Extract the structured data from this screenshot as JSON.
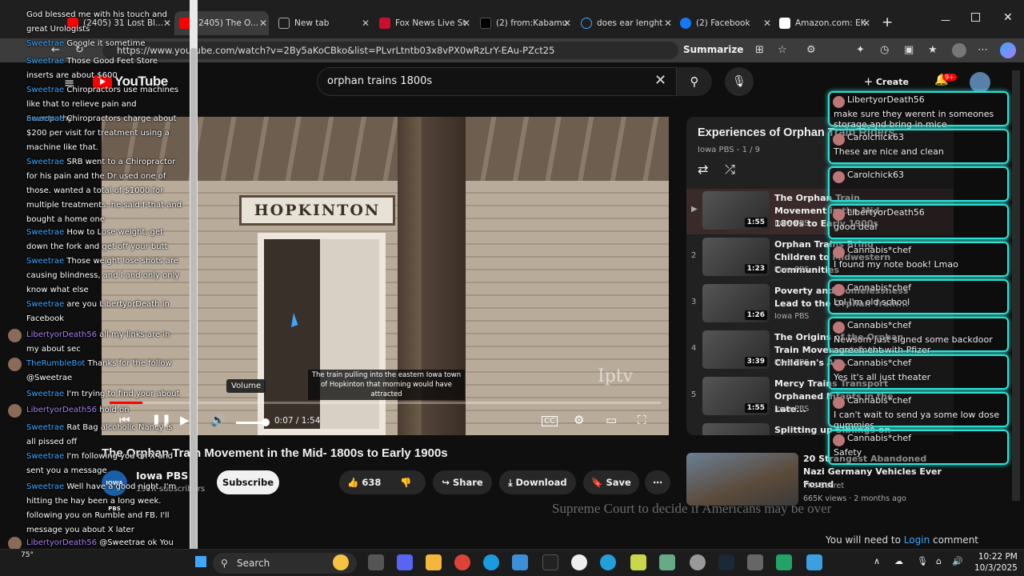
{
  "browser": {
    "tabs": [
      {
        "label": "(2405) 31 Lost Bl...",
        "icon": "youtube-icon"
      },
      {
        "label": "(2405) The O...",
        "icon": "youtube-icon",
        "active": true
      },
      {
        "label": "New tab",
        "icon": "newtab-icon"
      },
      {
        "label": "Fox News Live St",
        "icon": "fox-icon"
      },
      {
        "label": "(2) from:Kabamu",
        "icon": "x-icon"
      },
      {
        "label": "does ear lenght",
        "icon": "search-icon"
      },
      {
        "label": "(2) Facebook",
        "icon": "facebook-icon"
      },
      {
        "label": "Amazon.com: EK",
        "icon": "amazon-icon"
      }
    ],
    "url": "https://www.youtube.com/watch?v=2By5aKoCBko&list=PLvrLtntb03x8vPX0wRzLrY-EAu-PZct25",
    "summarize_label": "Summarize"
  },
  "youtube": {
    "logo_text": "YouTube",
    "search_query": "orphan trains 1800s",
    "create_label": "Create",
    "notification_badge": "9+",
    "sign_text": "HOPKINTON",
    "watermark": "Iptv",
    "caption": "The train pulling into the eastern Iowa town of Hopkinton that morning would have attracted",
    "volume_tooltip": "Volume",
    "time": "0:07 / 1:54",
    "progress": 0.06,
    "video_title": "The Orphan Train Movement in the Mid- 1800s to Early 1900s",
    "channel": {
      "name": "Iowa PBS",
      "logo": "IOWA PBS",
      "subscribers": "192K subscribers"
    },
    "subscribe_label": "Subscribe",
    "likes": "638",
    "share_label": "Share",
    "download_label": "Download",
    "save_label": "Save",
    "ticker_text": "Supreme Court to decide if Americans may be over",
    "playlist": {
      "title": "Experiences of Orphan Train Riders",
      "subtitle": "Iowa PBS - 1 / 9",
      "items": [
        {
          "index": "▶",
          "title": "The Orphan Train Movement in the Mid- 1800s to Early 1900s",
          "channel": "Iowa PBS",
          "duration": "1:55"
        },
        {
          "index": "2",
          "title": "Orphan Trains Bring Children to Midwestern Communities",
          "channel": "Iowa PBS",
          "duration": "1:23"
        },
        {
          "index": "3",
          "title": "Poverty and Homelessness Lead to the Orphan Train...",
          "channel": "Iowa PBS",
          "duration": "1:26"
        },
        {
          "index": "4",
          "title": "The Origins of the Orphan Train Movement & the Children's Ai...",
          "channel": "Iowa PBS",
          "duration": "3:39"
        },
        {
          "index": "5",
          "title": "Mercy Trains Transport Orphaned Infants in the Late...",
          "channel": "Iowa PBS",
          "duration": "1:55"
        },
        {
          "index": "",
          "title": "Splitting up Siblings on the...",
          "channel": "",
          "duration": ""
        }
      ]
    },
    "recommended": {
      "title": "20 Strangest Abandoned Nazi Germany Vehicles Ever Found",
      "channel": "The Secret",
      "meta": "665K views · 2 months ago"
    }
  },
  "chat_left": [
    {
      "user": "",
      "text": "God blessed me with his touch and great Urologists"
    },
    {
      "user": "Sweetrae",
      "text": "Google it sometime"
    },
    {
      "user": "Sweetrae",
      "text": "Those Good Feet Store inserts are about $600"
    },
    {
      "user": "Sweetrae",
      "text": "Chiropractors use machines like that to relieve pain and neuropathy"
    },
    {
      "user": "Sweetrae",
      "text": "Chiropractors charge about $200 per visit for treatment using a machine like that."
    },
    {
      "user": "Sweetrae",
      "text": "SRB went to a Chiropractor for his pain and the Dr used one of those. wanted a total of $1000 for multiple treatments. he said f that and bought a home one"
    },
    {
      "user": "Sweetrae",
      "text": "How to Lose weight, get down the fork and get off your butt"
    },
    {
      "user": "Sweetrae",
      "text": "Those weight lose shots are causing blindness, and I and only only know what else"
    },
    {
      "user": "Sweetrae",
      "text": "are you LibertyorDeath in Facebook"
    },
    {
      "user": "LibertyorDeath56",
      "text": "all my links are in my about sec"
    },
    {
      "user": "TheRumbleBot",
      "text": "Thanks for the follow @Sweetrae"
    },
    {
      "user": "Sweetrae",
      "text": "I'm trying to find your about"
    },
    {
      "user": "LibertyorDeath56",
      "text": "hold on"
    },
    {
      "user": "Sweetrae",
      "text": "Rat Bag alcoholic Nancy is all pissed off"
    },
    {
      "user": "Sweetrae",
      "text": "I'm following you on X and sent you a message"
    },
    {
      "user": "Sweetrae",
      "text": "Well have a good night. I'm hitting the hay been a long week. following you on Rumble and FB. I'll message you about X later"
    },
    {
      "user": "LibertyorDeath56",
      "text": "@Sweetrae ok You and the ole man have a good nite tnx 4 stopping by"
    }
  ],
  "chat_right": [
    {
      "user": "LibertyorDeath56",
      "text": "make sure they werent in someones storage and bring in mice"
    },
    {
      "user": "Carolchick63",
      "text": "These are nice and clean"
    },
    {
      "user": "Carolchick63",
      "text": ""
    },
    {
      "user": "LibertyorDeath56",
      "text": "good deal"
    },
    {
      "user": "Cannabis*chef",
      "text": "I found my note book! Lmao"
    },
    {
      "user": "Cannabis*chef",
      "text": "Lol I'm old school"
    },
    {
      "user": "Cannabis*chef",
      "text": "Newsom just signed some backdoor agreement with Pfizer"
    },
    {
      "user": "Cannabis*chef",
      "text": "Yes it's all just theater"
    },
    {
      "user": "Cannabis*chef",
      "text": "I can't wait to send ya some low dose gummies"
    },
    {
      "user": "Cannabis*chef",
      "text": "Safety"
    }
  ],
  "chat_footer": {
    "prefix": "You will need to ",
    "link": "Login",
    "suffix": " comment"
  },
  "taskbar": {
    "search_label": "Search",
    "time": "10:22 PM",
    "date": "10/3/2025",
    "weather": "75°"
  }
}
